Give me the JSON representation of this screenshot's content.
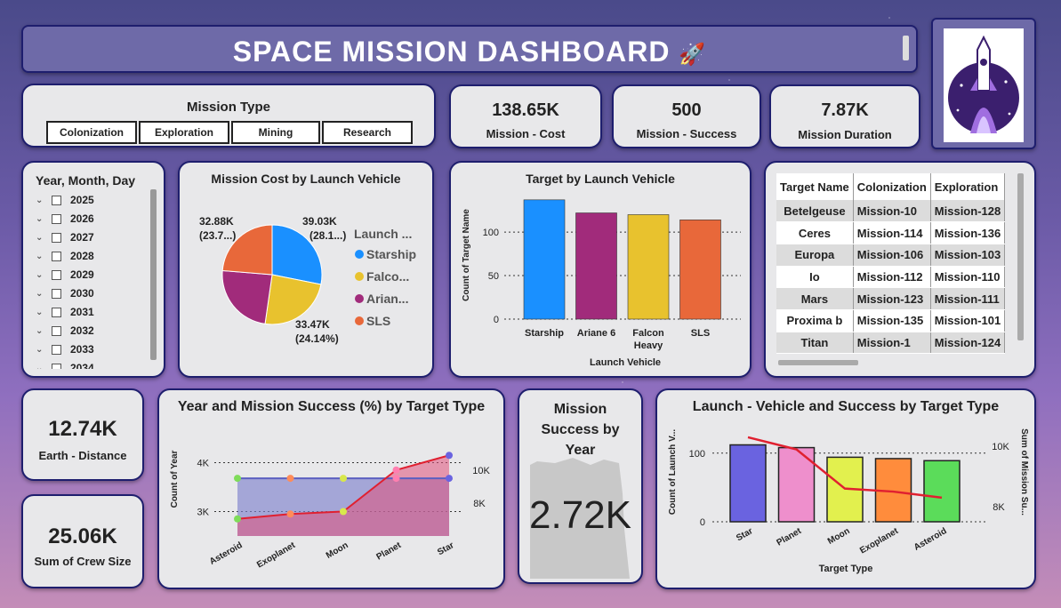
{
  "header": {
    "title": "SPACE MISSION DASHBOARD",
    "title_emoji": "🚀"
  },
  "logo": {
    "icon": "rocket-planet-logo-icon"
  },
  "mission_type": {
    "title": "Mission Type",
    "buttons": [
      "Colonization",
      "Exploration",
      "Mining",
      "Research"
    ]
  },
  "kpis": {
    "mission_cost": {
      "value": "138.65K",
      "label": "Mission - Cost"
    },
    "mission_success": {
      "value": "500",
      "label": "Mission - Success"
    },
    "mission_duration": {
      "value": "7.87K",
      "label": "Mission Duration"
    },
    "earth_distance": {
      "value": "12.74K",
      "label": "Earth - Distance"
    },
    "crew_size": {
      "value": "25.06K",
      "label": "Sum of Crew Size"
    },
    "success_by_year": {
      "value": "2.72K",
      "label": "Mission Success by Year"
    }
  },
  "date_slicer": {
    "title": "Year, Month, Day",
    "years": [
      "2025",
      "2026",
      "2027",
      "2028",
      "2029",
      "2030",
      "2031",
      "2032",
      "2033",
      "2034"
    ]
  },
  "colors": {
    "starship": "#1a90ff",
    "falcon": "#e8c22e",
    "ariane": "#a12b7b",
    "sls": "#e8683a",
    "navy": "#1e1e6e"
  },
  "target_table": {
    "headers": [
      "Target Name",
      "Colonization",
      "Exploration"
    ],
    "rows": [
      [
        "Betelgeuse",
        "Mission-10",
        "Mission-128"
      ],
      [
        "Ceres",
        "Mission-114",
        "Mission-136"
      ],
      [
        "Europa",
        "Mission-106",
        "Mission-103"
      ],
      [
        "Io",
        "Mission-112",
        "Mission-110"
      ],
      [
        "Mars",
        "Mission-123",
        "Mission-111"
      ],
      [
        "Proxima b",
        "Mission-135",
        "Mission-101"
      ],
      [
        "Titan",
        "Mission-1",
        "Mission-124"
      ]
    ]
  },
  "chart_data": [
    {
      "id": "pie",
      "type": "pie",
      "title": "Mission Cost by Launch Vehicle",
      "legend_title": "Launch ...",
      "legend_position": "right",
      "slices": [
        {
          "name": "Starship",
          "legend": "Starship",
          "value": 39.03,
          "label": "39.03K",
          "pct": "(28.1...)"
        },
        {
          "name": "Falcon Heavy",
          "legend": "Falco...",
          "value": 33.47,
          "label": "33.47K",
          "pct": "(24.14%)"
        },
        {
          "name": "Ariane 6",
          "legend": "Arian...",
          "value": 33.3,
          "label": "",
          "pct": ""
        },
        {
          "name": "SLS",
          "legend": "SLS",
          "value": 32.88,
          "label": "32.88K",
          "pct": "(23.7...)"
        }
      ]
    },
    {
      "id": "bar",
      "type": "bar",
      "title": "Target by Launch Vehicle",
      "xlabel": "Launch Vehicle",
      "ylabel": "Count of Target Name",
      "categories": [
        "Starship",
        "Ariane 6",
        "Falcon Heavy",
        "SLS"
      ],
      "category_lines": [
        [
          "Starship"
        ],
        [
          "Ariane 6"
        ],
        [
          "Falcon",
          "Heavy"
        ],
        [
          "SLS"
        ]
      ],
      "values": [
        137,
        122,
        120,
        114
      ],
      "ylim": [
        0,
        145
      ],
      "yticks": [
        0,
        50,
        100
      ],
      "grid": true
    },
    {
      "id": "area",
      "type": "area",
      "title": "Year and Mission Success (%) by Target Type",
      "categories": [
        "Asteroid",
        "Exoplanet",
        "Moon",
        "Planet",
        "Star"
      ],
      "ylabel": "Count of Year",
      "yticks_left": [
        "3K",
        "4K"
      ],
      "yticks_right": [
        "8K",
        "10K"
      ],
      "series": [
        {
          "values": [
            3.68,
            3.68,
            3.68,
            3.68,
            3.68
          ],
          "axis": "left",
          "color": "#7f82cc"
        },
        {
          "values": [
            2.85,
            2.95,
            3.0,
            3.85,
            4.15
          ],
          "axis": "left",
          "color": "#e0507a"
        }
      ],
      "ylim_left": [
        2.5,
        4.5
      ]
    },
    {
      "id": "combo",
      "type": "bar",
      "title": "Launch - Vehicle and Success by Target Type",
      "xlabel": "Target Type",
      "ylabel": "Count of Launch V...",
      "ylabel_right": "Sum of Mission Su...",
      "categories": [
        "Star",
        "Planet",
        "Moon",
        "Exoplanet",
        "Asteroid"
      ],
      "values": [
        112,
        108,
        94,
        92,
        89
      ],
      "bar_colors": [
        "#6a63e0",
        "#ee8fcc",
        "#e2f04e",
        "#ff8c3c",
        "#5bdc5a"
      ],
      "yticks": [
        0,
        100
      ],
      "yticks_right": [
        "8K",
        "10K"
      ],
      "ylim": [
        0,
        145
      ],
      "line": {
        "values": [
          10.3,
          9.9,
          8.6,
          8.5,
          8.3
        ],
        "ylim": [
          7.5,
          10.8
        ],
        "color": "#e02030"
      }
    }
  ]
}
